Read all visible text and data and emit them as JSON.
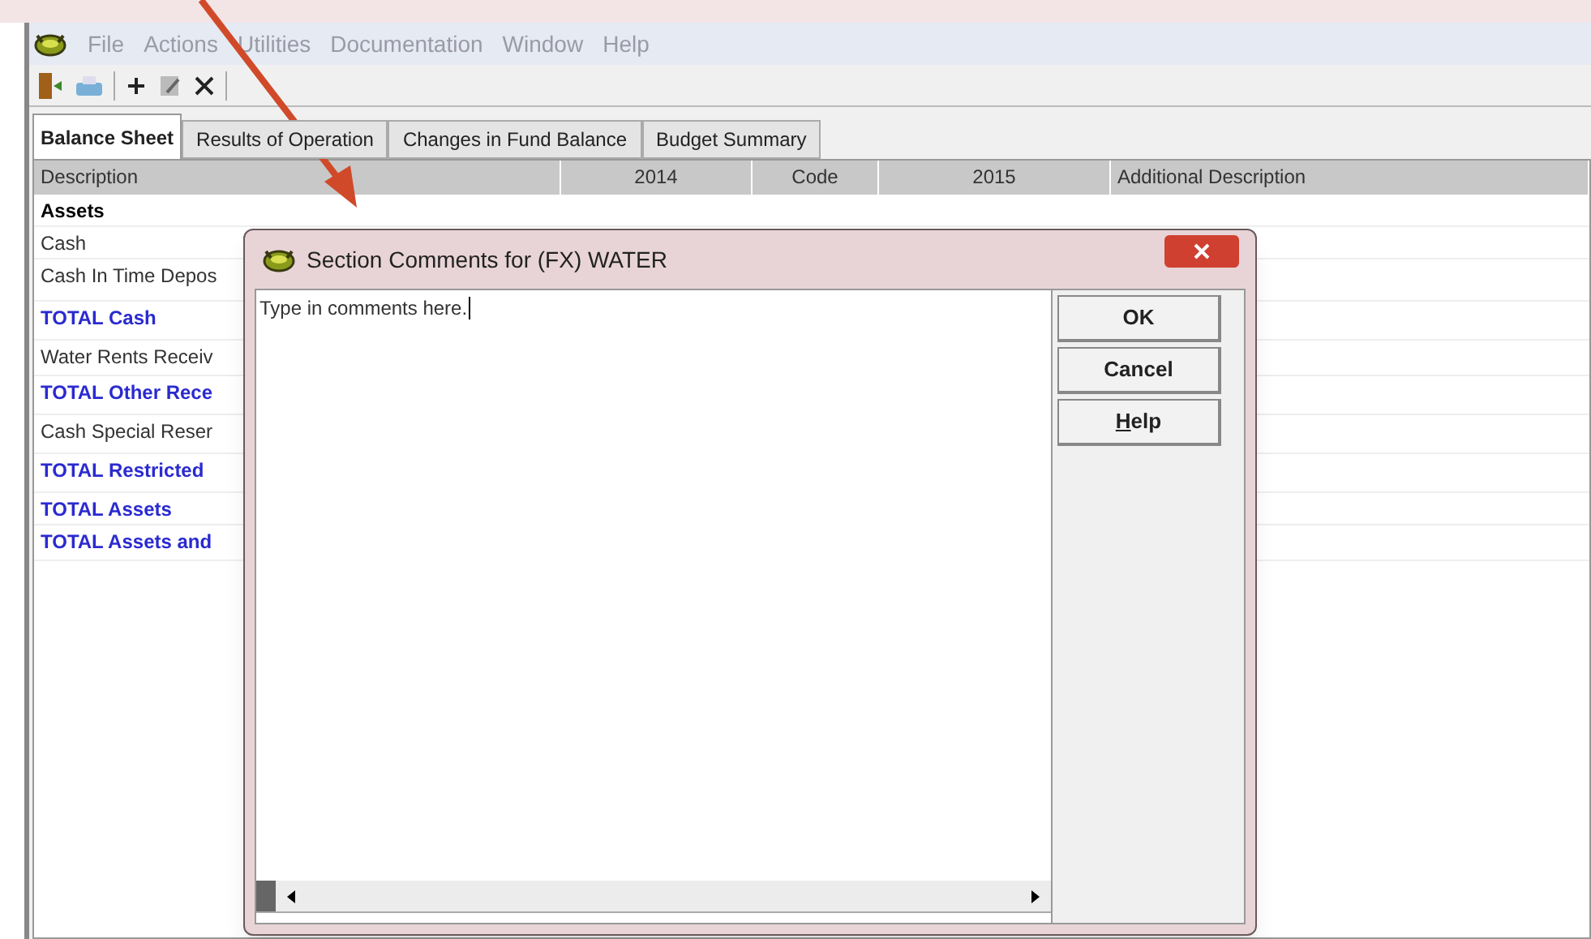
{
  "menu": [
    "File",
    "Actions",
    "Utilities",
    "Documentation",
    "Window",
    "Help"
  ],
  "tabs": [
    {
      "label": "Balance Sheet",
      "selected": true
    },
    {
      "label": "Results of Operation",
      "selected": false
    },
    {
      "label": "Changes in Fund Balance",
      "selected": false
    },
    {
      "label": "Budget Summary",
      "selected": false
    }
  ],
  "table": {
    "columns": [
      "Description",
      "2014",
      "Code",
      "2015",
      "Additional Description"
    ],
    "rows": [
      {
        "label": "Assets",
        "kind": "heading"
      },
      {
        "label": "Cash",
        "kind": "item"
      },
      {
        "label": "Cash In Time Depos",
        "kind": "item"
      },
      {
        "label": "TOTAL Cash",
        "kind": "total"
      },
      {
        "label": "Water Rents Receiv",
        "kind": "item"
      },
      {
        "label": "TOTAL Other Rece",
        "kind": "total"
      },
      {
        "label": "Cash Special Reser",
        "kind": "item"
      },
      {
        "label": "TOTAL Restricted",
        "kind": "total"
      },
      {
        "label": "TOTAL Assets",
        "kind": "total"
      },
      {
        "label": "TOTAL Assets and",
        "kind": "total"
      }
    ]
  },
  "dialog": {
    "title": "Section Comments for (FX) WATER",
    "comment": "Type in comments here.",
    "buttons": [
      {
        "label": "OK",
        "underline_first": false
      },
      {
        "label": "Cancel",
        "underline_first": false
      },
      {
        "label": "Help",
        "underline_first": true
      }
    ]
  }
}
